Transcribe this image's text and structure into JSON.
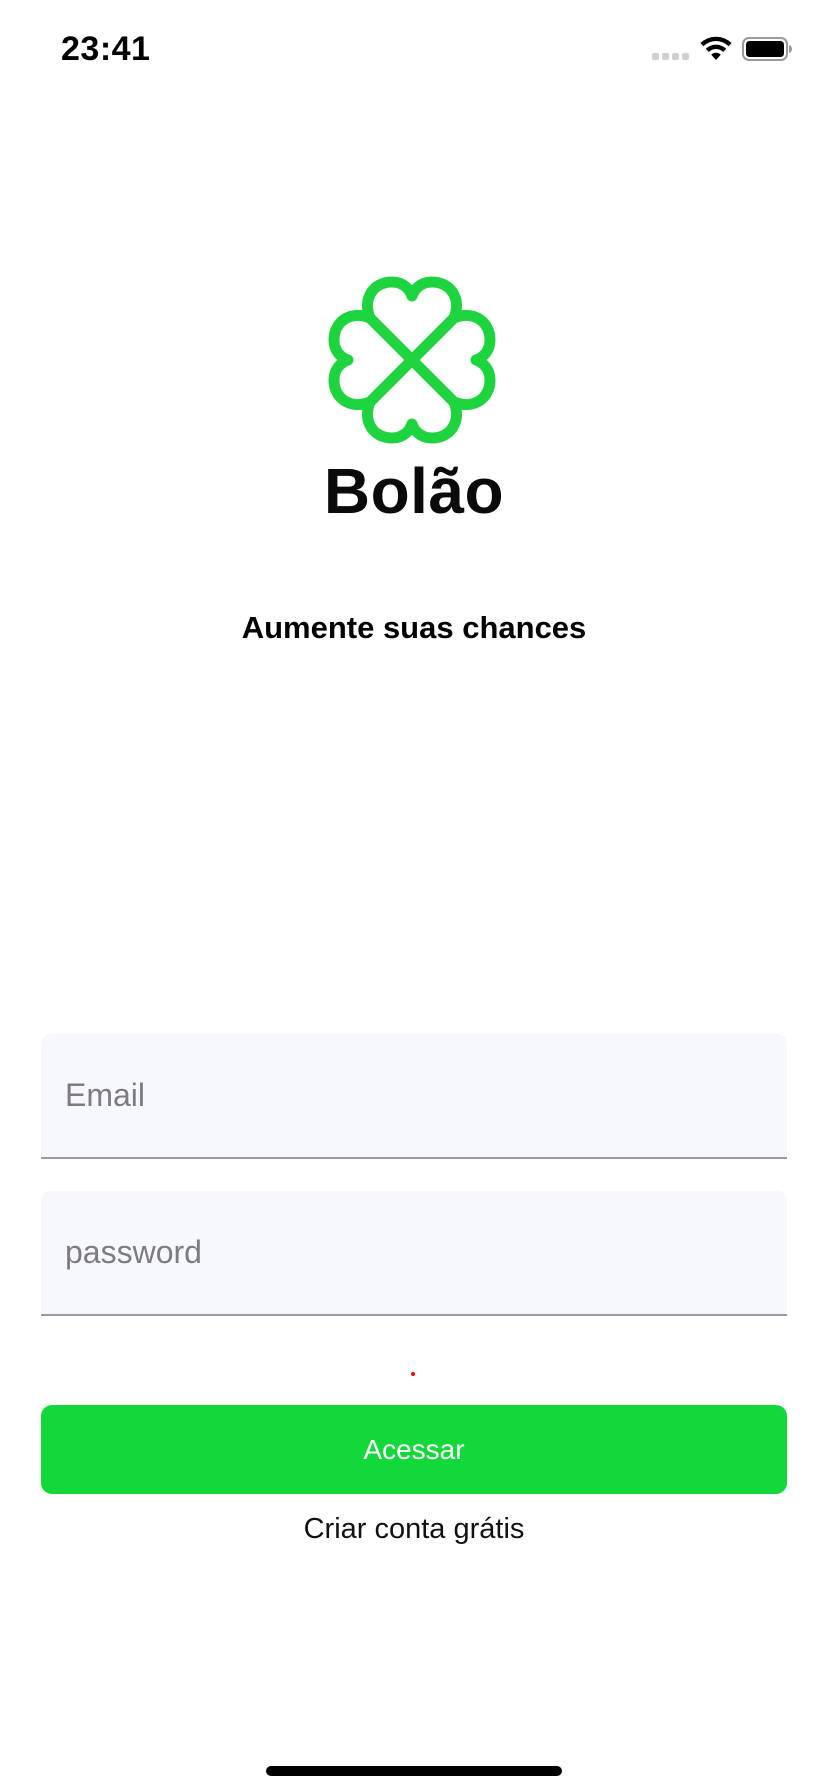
{
  "status_bar": {
    "time": "23:41",
    "icons": [
      "signal-icon",
      "wifi-icon",
      "battery-icon"
    ]
  },
  "brand": {
    "logo_icon": "clover-icon",
    "name": "Bolão",
    "color": "#1ed43e"
  },
  "tagline": "Aumente suas chances",
  "form": {
    "email": {
      "value": "",
      "placeholder": "Email"
    },
    "password": {
      "value": "",
      "placeholder": "password"
    },
    "error_color": "#e01010"
  },
  "actions": {
    "submit_label": "Acessar",
    "submit_color": "#12d939",
    "create_account_label": "Criar conta grátis"
  }
}
